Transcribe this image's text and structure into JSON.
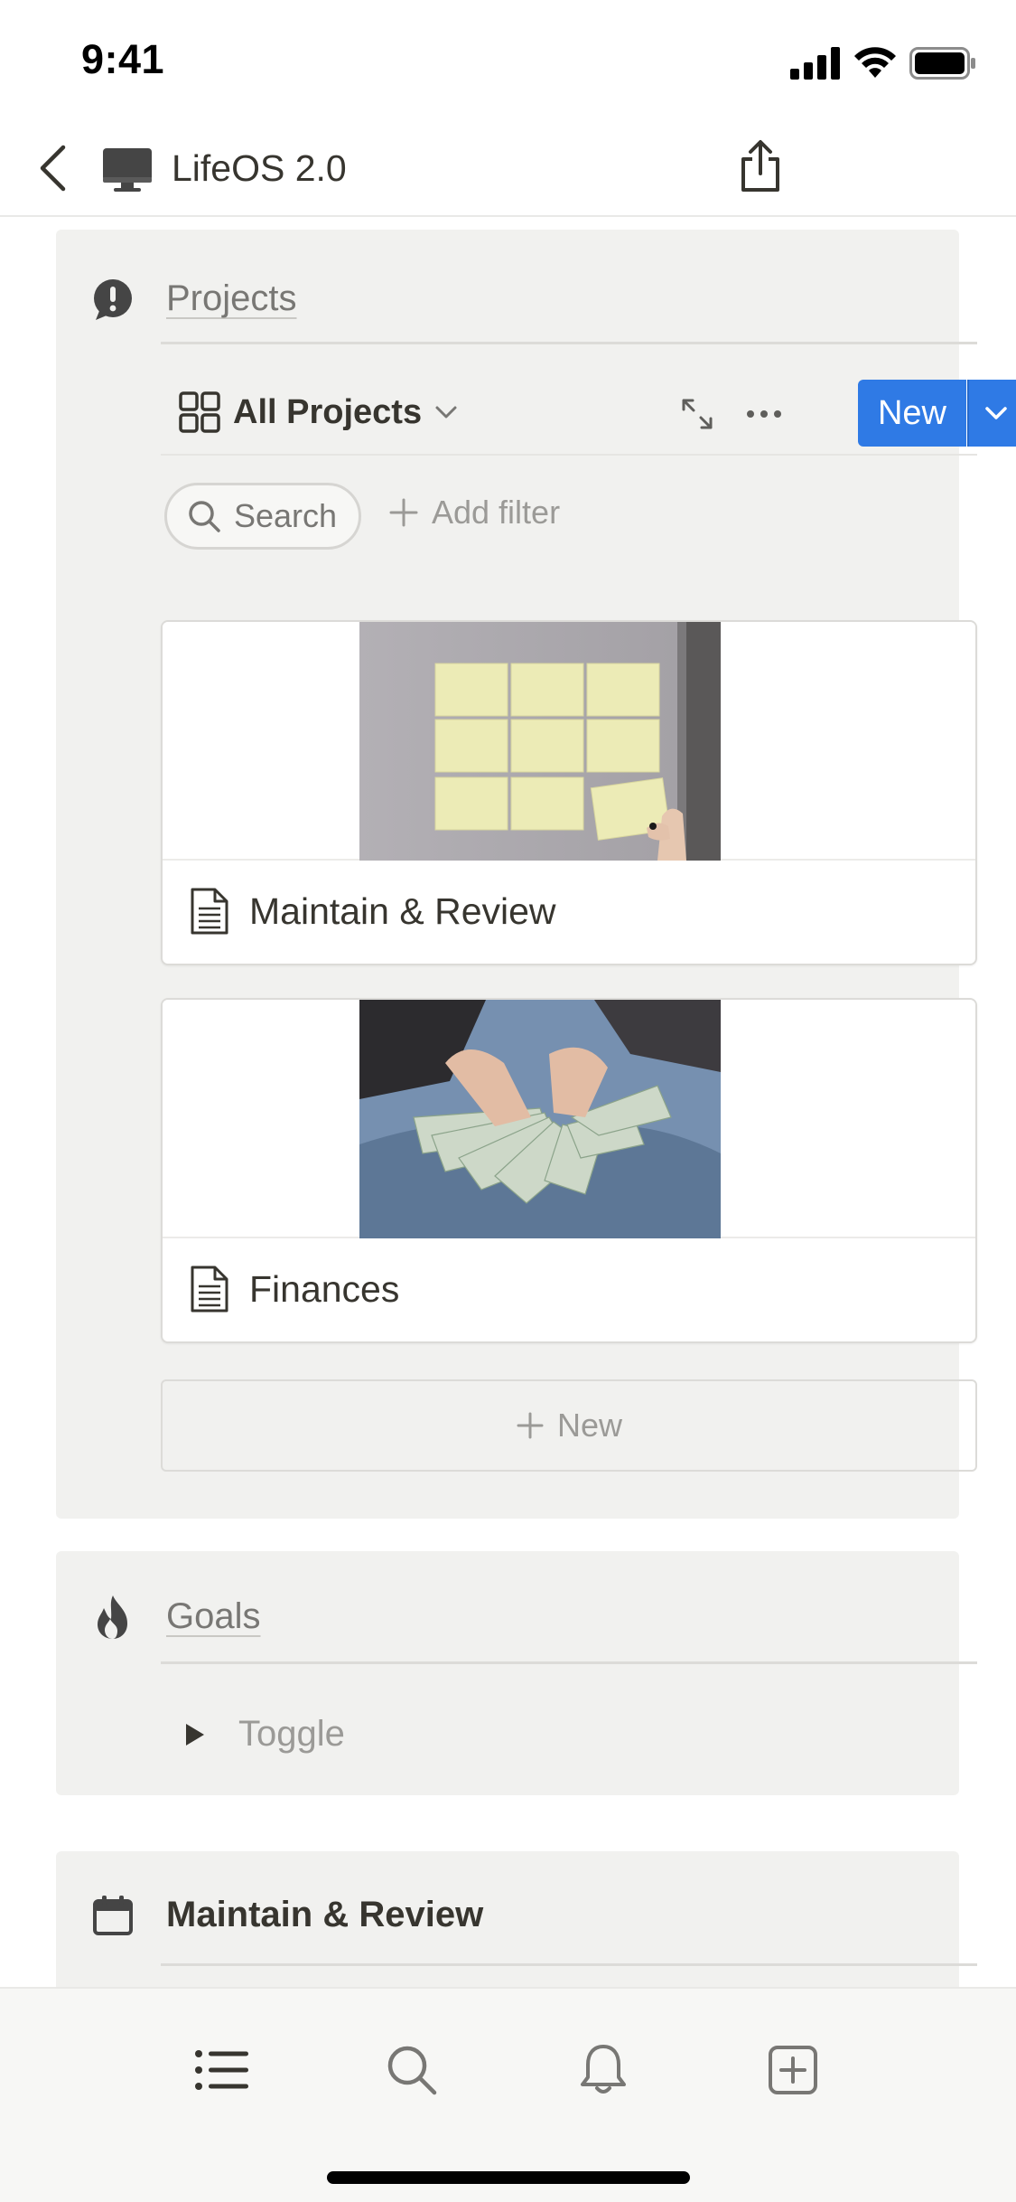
{
  "status_bar": {
    "time": "9:41"
  },
  "nav": {
    "title": "LifeOS 2.0"
  },
  "projects": {
    "heading": "Projects",
    "view_label": "All Projects",
    "new_label": "New",
    "search_label": "Search",
    "add_filter_label": "Add filter",
    "cards": [
      {
        "title": "Maintain & Review"
      },
      {
        "title": "Finances"
      }
    ],
    "new_row_label": "New"
  },
  "goals": {
    "heading": "Goals",
    "toggle_label": "Toggle"
  },
  "maintain": {
    "heading": "Maintain & Review"
  },
  "colors": {
    "accent": "#2f7ae5",
    "callout_bg": "#f1f1ef",
    "text": "#37352f"
  },
  "tab_bar": {
    "items": [
      "list-icon",
      "search-icon",
      "bell-icon",
      "new-page-icon"
    ]
  }
}
